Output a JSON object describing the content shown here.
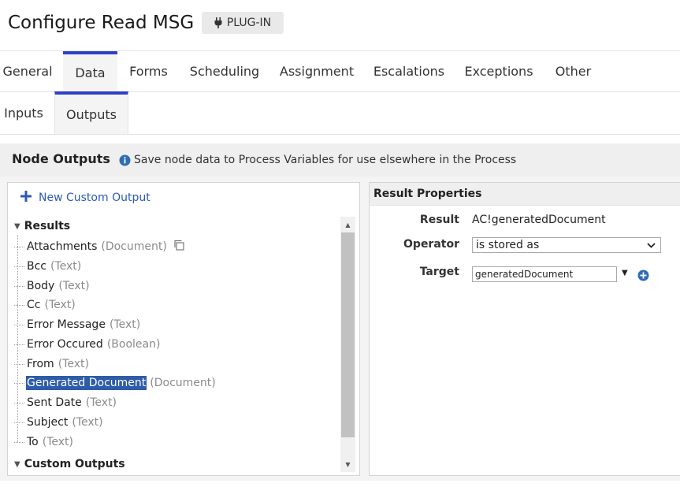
{
  "header": {
    "title": "Configure Read MSG",
    "badge_label": "PLUG-IN",
    "badge_icon": "plug-icon"
  },
  "main_tabs": [
    {
      "label": "General",
      "active": false
    },
    {
      "label": "Data",
      "active": true
    },
    {
      "label": "Forms",
      "active": false
    },
    {
      "label": "Scheduling",
      "active": false
    },
    {
      "label": "Assignment",
      "active": false
    },
    {
      "label": "Escalations",
      "active": false
    },
    {
      "label": "Exceptions",
      "active": false
    },
    {
      "label": "Other",
      "active": false
    }
  ],
  "sub_tabs": [
    {
      "label": "Inputs",
      "active": false
    },
    {
      "label": "Outputs",
      "active": true
    }
  ],
  "node_outputs": {
    "title": "Node Outputs",
    "info_text": "Save node data to Process Variables for use elsewhere in the Process"
  },
  "tree": {
    "new_output_label": "New Custom Output",
    "results_label": "Results",
    "items": [
      {
        "name": "Attachments",
        "type": "(Document)"
      },
      {
        "name": "Bcc",
        "type": "(Text)"
      },
      {
        "name": "Body",
        "type": "(Text)"
      },
      {
        "name": "Cc",
        "type": "(Text)"
      },
      {
        "name": "Error Message",
        "type": "(Text)"
      },
      {
        "name": "Error Occured",
        "type": "(Boolean)"
      },
      {
        "name": "From",
        "type": "(Text)"
      },
      {
        "name": "Generated Document",
        "type": "(Document)"
      },
      {
        "name": "Sent Date",
        "type": "(Text)"
      },
      {
        "name": "Subject",
        "type": "(Text)"
      },
      {
        "name": "To",
        "type": "(Text)"
      }
    ],
    "selected": "Generated Document",
    "custom_outputs_label": "Custom Outputs"
  },
  "result_properties": {
    "title": "Result Properties",
    "result_label": "Result",
    "result_value": "AC!generatedDocument",
    "operator_label": "Operator",
    "operator_value": "is stored as",
    "target_label": "Target",
    "target_value": "generatedDocument"
  },
  "colors": {
    "accent": "#2f3ec9",
    "link": "#2f59b4",
    "selection": "#2e5ca8"
  }
}
